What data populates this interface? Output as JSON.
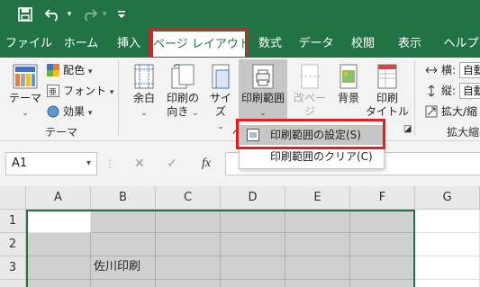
{
  "quick_access": {
    "save_icon": "save-icon",
    "undo_icon": "undo-icon",
    "redo_icon": "redo-icon",
    "customize_icon": "customize-icon"
  },
  "tabs": [
    {
      "label": "ファイル"
    },
    {
      "label": "ホーム"
    },
    {
      "label": "挿入"
    },
    {
      "label": "ページ レイアウト"
    },
    {
      "label": "数式"
    },
    {
      "label": "データ"
    },
    {
      "label": "校閲"
    },
    {
      "label": "表示"
    },
    {
      "label": "ヘルプ"
    }
  ],
  "ribbon": {
    "theme_group": {
      "themes_label": "テーマ",
      "colors_label": "配色",
      "fonts_label": "フォント",
      "effects_label": "効果",
      "group_label": "テーマ"
    },
    "page_setup": {
      "margins_label": "余白",
      "orientation_label_1": "印刷の",
      "orientation_label_2": "向き",
      "size_label": "サイズ",
      "print_area_label": "印刷範囲",
      "breaks_label": "改ページ",
      "background_label": "背景",
      "print_titles_label_1": "印刷",
      "print_titles_label_2": "タイトル",
      "group_initial": "ペ"
    },
    "scale_group": {
      "width_label": "横:",
      "height_label": "縦:",
      "width_value": "自動",
      "height_value": "自動",
      "scale_label": "拡大/縮",
      "group_label": "拡大縮"
    }
  },
  "dropdown": {
    "set_print_area": "印刷範囲の設定(S)",
    "clear_print_area": "印刷範囲のクリア(C)"
  },
  "formula_bar": {
    "name_box": "A1",
    "cancel_symbol": "✕",
    "enter_symbol": "✓",
    "fx_symbol": "fx",
    "formula": ""
  },
  "sheet": {
    "columns": [
      "A",
      "B",
      "C",
      "D",
      "E",
      "F",
      "G"
    ],
    "rows": [
      "1",
      "2",
      "3"
    ],
    "cells": {
      "B3": "佐川印刷"
    }
  },
  "colors": {
    "excel_green": "#217346",
    "highlight_red": "#e02020",
    "selection_gray": "#d0d0d0"
  }
}
